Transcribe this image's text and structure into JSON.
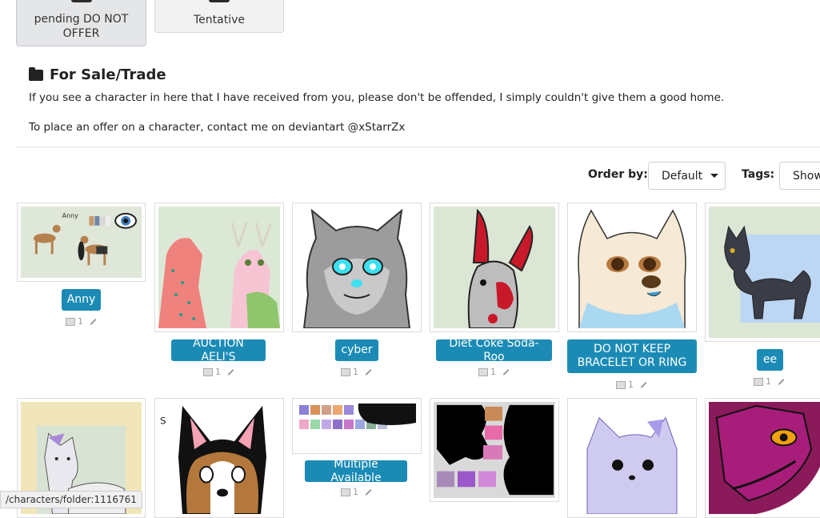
{
  "top_tiles": [
    {
      "label": "pending DO NOT OFFER"
    },
    {
      "label": "Tentative"
    }
  ],
  "folder": {
    "title": "For Sale/Trade",
    "desc1": "If you see a character in here that I have received from you, please don't be offended, I simply couldn't give them a good home.",
    "desc2": "To place an offer on a character, contact me on deviantart @xStarrZx"
  },
  "toolbar": {
    "order_label": "Order by:",
    "order_value": "Default",
    "tags_label": "Tags:",
    "tags_value": "Show"
  },
  "characters": [
    {
      "name": "Anny",
      "count": "1"
    },
    {
      "name": "AUCTION AELI'S",
      "count": "1"
    },
    {
      "name": "cyber",
      "count": "1"
    },
    {
      "name": "Diet Coke Soda-Roo",
      "count": "1"
    },
    {
      "name": "DO NOT KEEP BRACELET OR RING",
      "count": "1"
    },
    {
      "name": "ee",
      "count": "1"
    },
    {
      "name": "Multiple Available",
      "count": "1"
    }
  ],
  "status_url": "/characters/folder:1116761",
  "colors": {
    "accent": "#1b8bb6"
  }
}
